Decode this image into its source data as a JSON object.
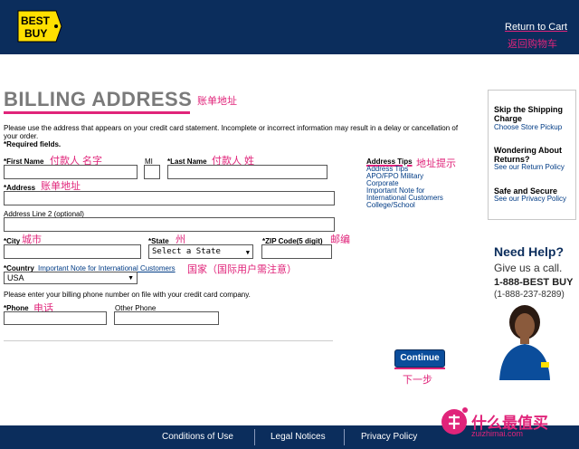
{
  "header": {
    "logo_text_1": "BEST",
    "logo_text_2": "BUY",
    "return_to_cart": "Return to Cart",
    "return_to_cart_cn": "返回购物车"
  },
  "page": {
    "title": "BILLING ADDRESS",
    "title_cn": "账单地址",
    "intro": "Please use the address that appears on your credit card statement. Incomplete or incorrect information may result in a delay or cancellation of your order.",
    "required": "*Required fields."
  },
  "form": {
    "first_name": {
      "label": "*First Name",
      "cn": "付款人 名字",
      "value": ""
    },
    "mi": {
      "label": "MI",
      "value": ""
    },
    "last_name": {
      "label": "*Last Name",
      "cn": "付款人 姓",
      "value": ""
    },
    "address": {
      "label": "*Address",
      "cn": "账单地址",
      "value": ""
    },
    "address2": {
      "label": "Address Line 2 (optional)",
      "value": ""
    },
    "city": {
      "label": "*City",
      "cn": "城市",
      "value": ""
    },
    "state": {
      "label": "*State",
      "cn": "州",
      "selected": "Select a State"
    },
    "zip": {
      "label": "*ZIP Code(5 digit)",
      "cn": "邮编",
      "value": ""
    },
    "country": {
      "label": "*Country",
      "link": "Important Note for International Customers",
      "cn": "国家（国际用户需注意）",
      "selected": "USA"
    },
    "phone_note": "Please enter your billing phone number on file with your credit card company.",
    "phone": {
      "label": "*Phone",
      "cn": "电话",
      "value": ""
    },
    "other_phone": {
      "label": "Other Phone",
      "value": ""
    }
  },
  "tips": {
    "title": "Address Tips",
    "title_cn": "地址提示",
    "links": [
      "Address Tips",
      "APO/FPO Military",
      "Corporate",
      "Important Note for",
      "International Customers",
      "College/School"
    ]
  },
  "actions": {
    "continue": "Continue",
    "continue_cn": "下一步"
  },
  "sidebar": {
    "shipping_title_1": "Skip the Shipping",
    "shipping_title_2": "Charge",
    "shipping_link": "Choose Store Pickup",
    "returns_title_1": "Wondering About",
    "returns_title_2": "Returns?",
    "returns_link": "See our Return Policy",
    "secure_title": "Safe and Secure",
    "secure_link": "See our Privacy Policy"
  },
  "help": {
    "title": "Need Help?",
    "subtitle": "Give us a call.",
    "phone": "1-888-BEST BUY",
    "phone_digits": "(1-888-237-8289)"
  },
  "footer": {
    "conditions": "Conditions of Use",
    "legal": "Legal Notices",
    "privacy": "Privacy Policy"
  },
  "watermark": {
    "text": "什么最值买",
    "sub": "zuizhimai.com"
  },
  "colors": {
    "header_bg": "#0b2d5c",
    "annotation": "#e0247a",
    "logo_yellow": "#ffe000",
    "button": "#0b4d9b"
  }
}
